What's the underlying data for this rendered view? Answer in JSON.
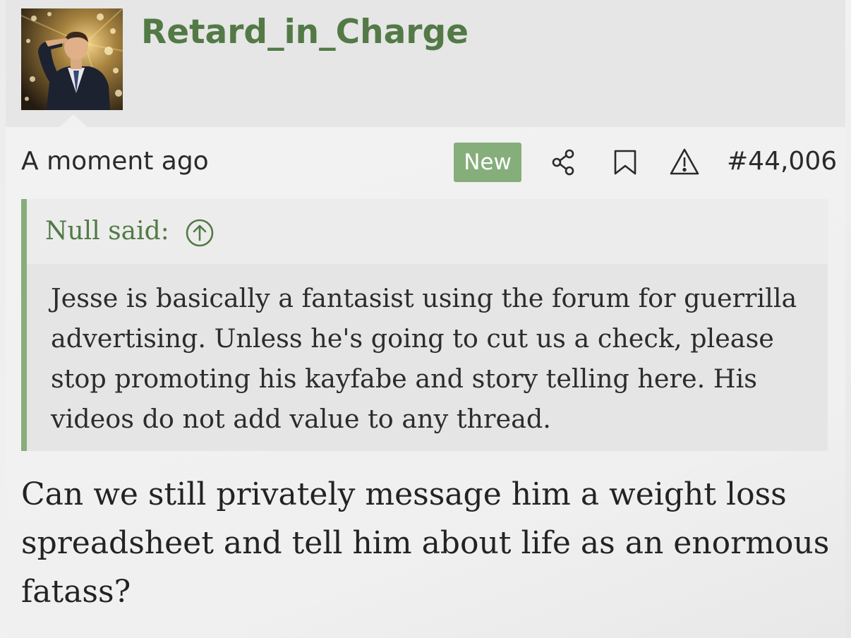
{
  "post": {
    "username": "Retard_in_Charge",
    "avatar_icon": "saluting-man-avatar",
    "timestamp": "A moment ago",
    "new_badge": "New",
    "post_number": "#44,006",
    "actions": {
      "share_icon": "share-icon",
      "bookmark_icon": "bookmark-icon",
      "report_icon": "warning-icon"
    },
    "quote": {
      "author_label": "Null said:",
      "jump_icon": "arrow-up-circle-icon",
      "lines": [
        "Jesse is basically a fantasist using the forum for guerrilla",
        "advertising. Unless he's going to cut us a check, please",
        "stop promoting his kayfabe and story telling here. His",
        "videos do not add value to any thread."
      ]
    },
    "message_lines": [
      "Can we still privately message him a weight loss",
      "spreadsheet and tell him about life as an enormous",
      "fatass?"
    ]
  },
  "colors": {
    "accent_green": "#537a46",
    "badge_green": "#86ae7a",
    "quote_bg": "#e5e5e5",
    "header_bg": "#e6e6e6"
  }
}
